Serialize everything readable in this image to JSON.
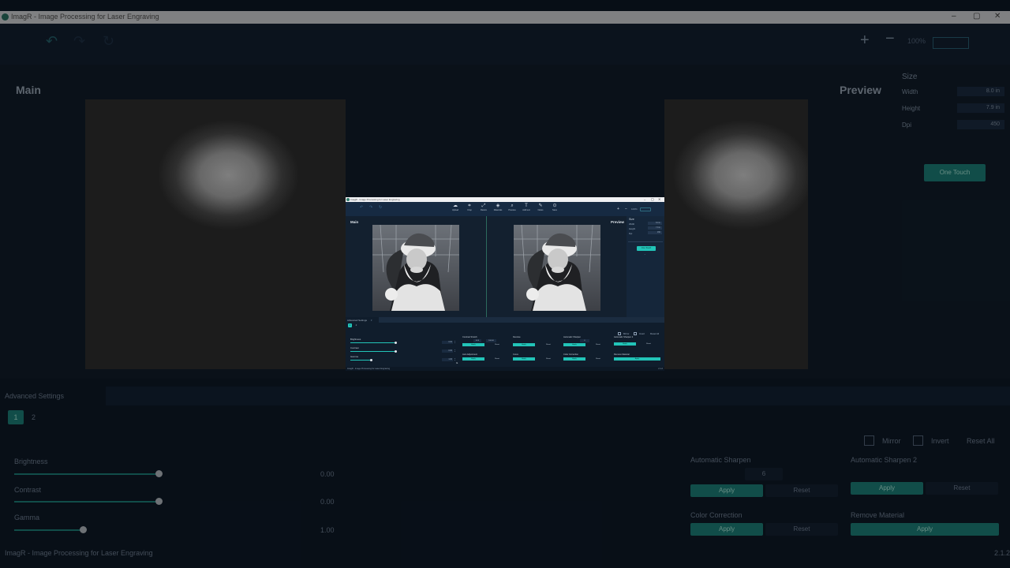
{
  "window": {
    "title": "ImagR - Image Processing for Laser Engraving",
    "minimize_icon": "minimize-icon",
    "maximize_icon": "maximize-icon",
    "close_icon": "close-icon"
  },
  "toolbar": {
    "undo_icon": "undo-icon",
    "redo_icon": "redo-icon",
    "refresh_icon": "refresh-icon",
    "tools": [
      {
        "label": "Upload",
        "icon": "upload-icon"
      },
      {
        "label": "Crop",
        "icon": "crop-icon"
      },
      {
        "label": "Resize",
        "icon": "resize-icon"
      },
      {
        "label": "Materials",
        "icon": "materials-icon"
      },
      {
        "label": "Preview",
        "icon": "magnify-icon"
      },
      {
        "label": "Add text",
        "icon": "text-icon"
      },
      {
        "label": "Notes",
        "icon": "notes-icon"
      },
      {
        "label": "Save",
        "icon": "save-icon"
      }
    ],
    "zoom_in_icon": "plus-icon",
    "zoom_out_icon": "minus-icon",
    "zoom_value": "100%"
  },
  "main": {
    "main_label": "Main",
    "preview_label": "Preview"
  },
  "size_panel": {
    "title": "Size",
    "width_label": "Width",
    "width_value": "8.0 in",
    "height_label": "Height",
    "height_value": "7.9 in",
    "dpi_label": "Dpi",
    "dpi_value": "450",
    "one_touch_label": "One Touch",
    "expand_icon": "chevron-down-icon"
  },
  "advanced": {
    "header": "Advanced Settings",
    "pages": [
      "1",
      "2"
    ],
    "mirror_label": "Mirror",
    "invert_label": "Invert",
    "reset_all_label": "Reset All",
    "sliders": [
      {
        "label": "Brightness",
        "value": "0.00",
        "level": 0.5
      },
      {
        "label": "Contrast",
        "value": "0.00",
        "level": 0.5
      },
      {
        "label": "Gamma",
        "value": "1.00",
        "level": 0.23
      }
    ],
    "blocks": [
      {
        "title": "Contrast Stretch",
        "low": "0.00",
        "high": "100.00",
        "apply": "Apply",
        "reset": "Reset"
      },
      {
        "title": "Denoise",
        "apply": "Apply",
        "reset": "Reset"
      },
      {
        "title": "Automatic Sharpen",
        "num": "6",
        "apply": "Apply",
        "reset": "Reset"
      },
      {
        "title": "Automatic Sharpen 2",
        "apply": "Apply",
        "reset": "Reset"
      },
      {
        "title": "Auto Adjustment",
        "apply": "Apply",
        "reset": "Reset"
      },
      {
        "title": "Curve",
        "apply": "Apply",
        "reset": "Reset"
      },
      {
        "title": "Color Correction",
        "apply": "Apply",
        "reset": "Reset"
      },
      {
        "title": "Remove Material",
        "apply": "Apply"
      }
    ]
  },
  "status": {
    "text": "ImagR - Image Processing for Laser Engraving",
    "version": "2.1.2"
  }
}
